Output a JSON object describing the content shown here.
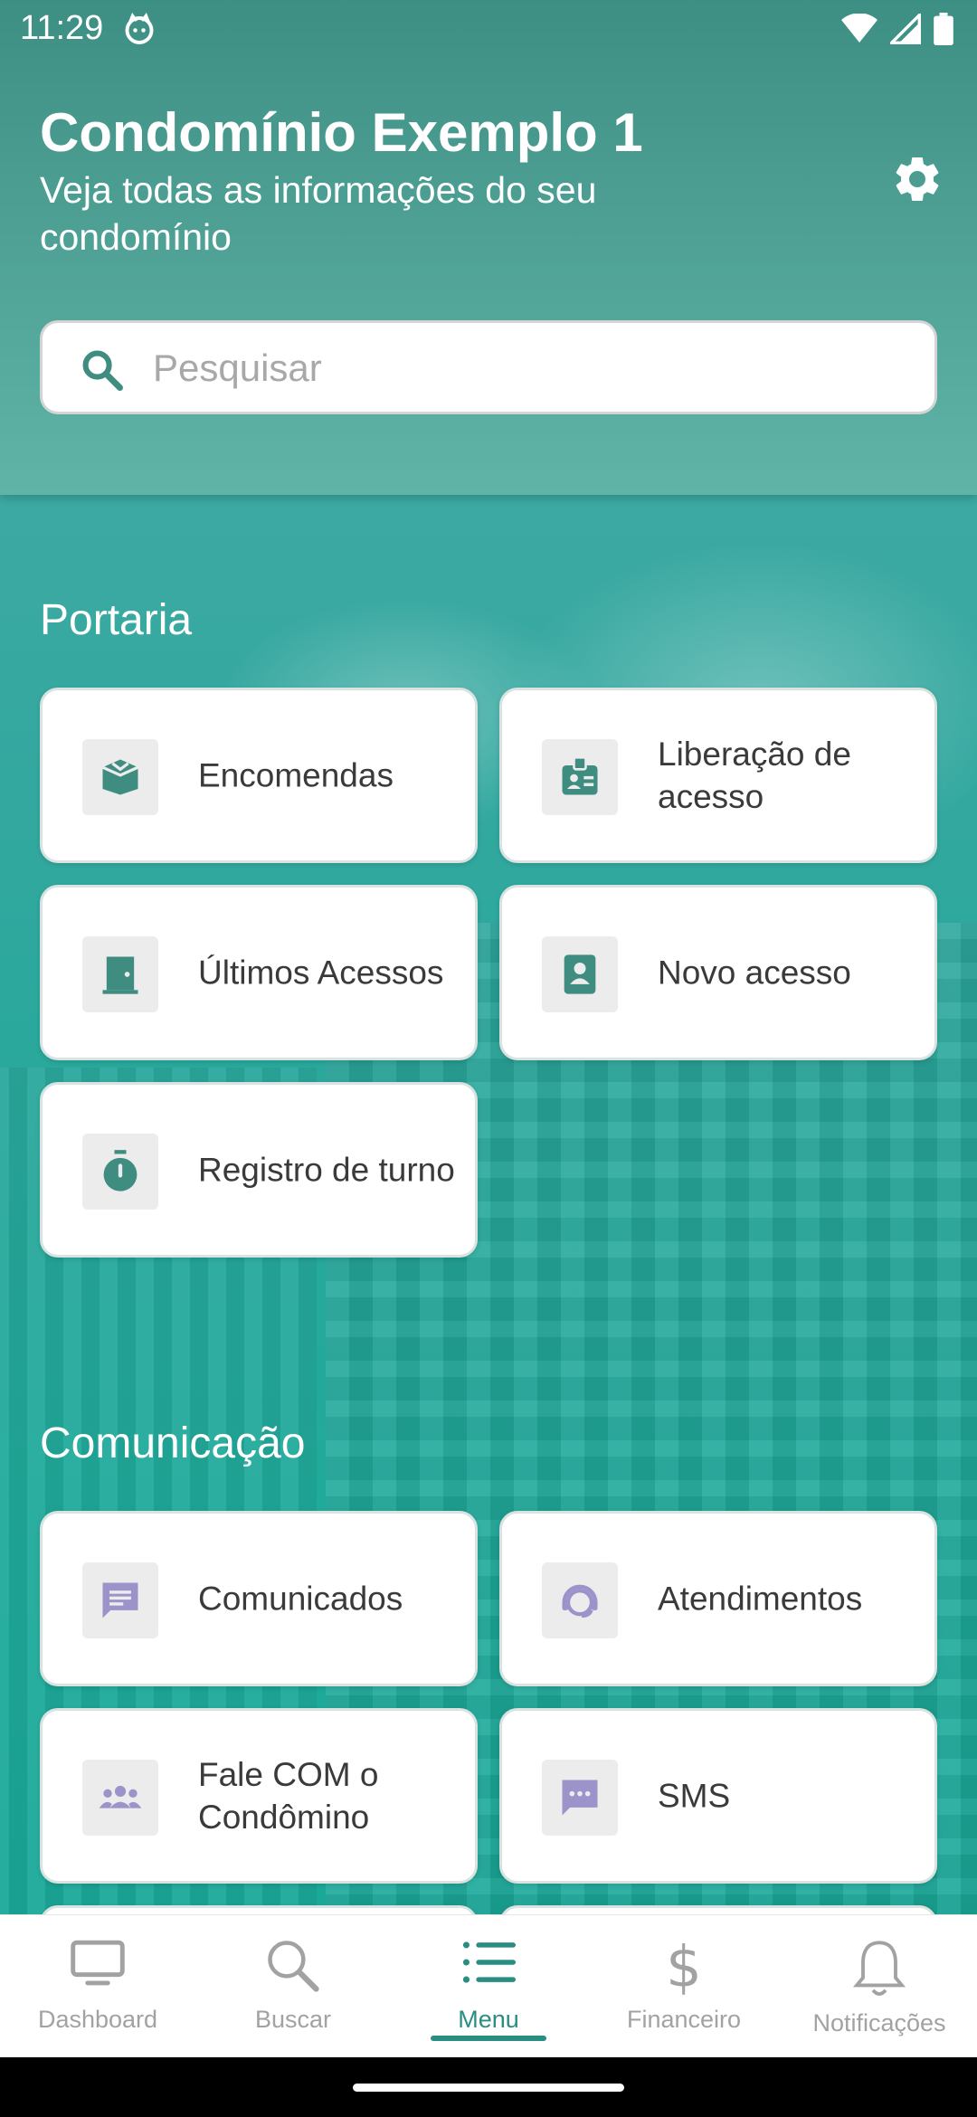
{
  "status_bar": {
    "time": "11:29"
  },
  "header": {
    "title": "Condomínio Exemplo 1",
    "subtitle": "Veja todas as informações do seu condomínio",
    "search_placeholder": "Pesquisar",
    "search_value": ""
  },
  "sections": [
    {
      "title": "Portaria",
      "items": [
        {
          "label": "Encomendas",
          "icon": "package-icon"
        },
        {
          "label": "Liberação de acesso",
          "icon": "id-badge-icon"
        },
        {
          "label": "Últimos Acessos",
          "icon": "door-icon"
        },
        {
          "label": "Novo acesso",
          "icon": "contact-card-icon"
        },
        {
          "label": "Registro de turno",
          "icon": "stopwatch-icon"
        }
      ]
    },
    {
      "title": "Comunicação",
      "items": [
        {
          "label": "Comunicados",
          "icon": "message-icon"
        },
        {
          "label": "Atendimentos",
          "icon": "support-agent-icon"
        },
        {
          "label": "Fale COM o Condômino",
          "icon": "group-icon"
        },
        {
          "label": "SMS",
          "icon": "sms-icon"
        }
      ]
    }
  ],
  "bottom_nav": [
    {
      "label": "Dashboard",
      "icon": "monitor-icon",
      "active": false
    },
    {
      "label": "Buscar",
      "icon": "search-icon",
      "active": false
    },
    {
      "label": "Menu",
      "icon": "list-icon",
      "active": true
    },
    {
      "label": "Financeiro",
      "icon": "dollar-icon",
      "active": false
    },
    {
      "label": "Notificações",
      "icon": "bell-icon",
      "active": false
    }
  ],
  "colors": {
    "header": "#4c9e92",
    "accent": "#2a8d81",
    "portaria_icon": "#3f8c80",
    "comunicacao_icon": "#9b93c9"
  }
}
